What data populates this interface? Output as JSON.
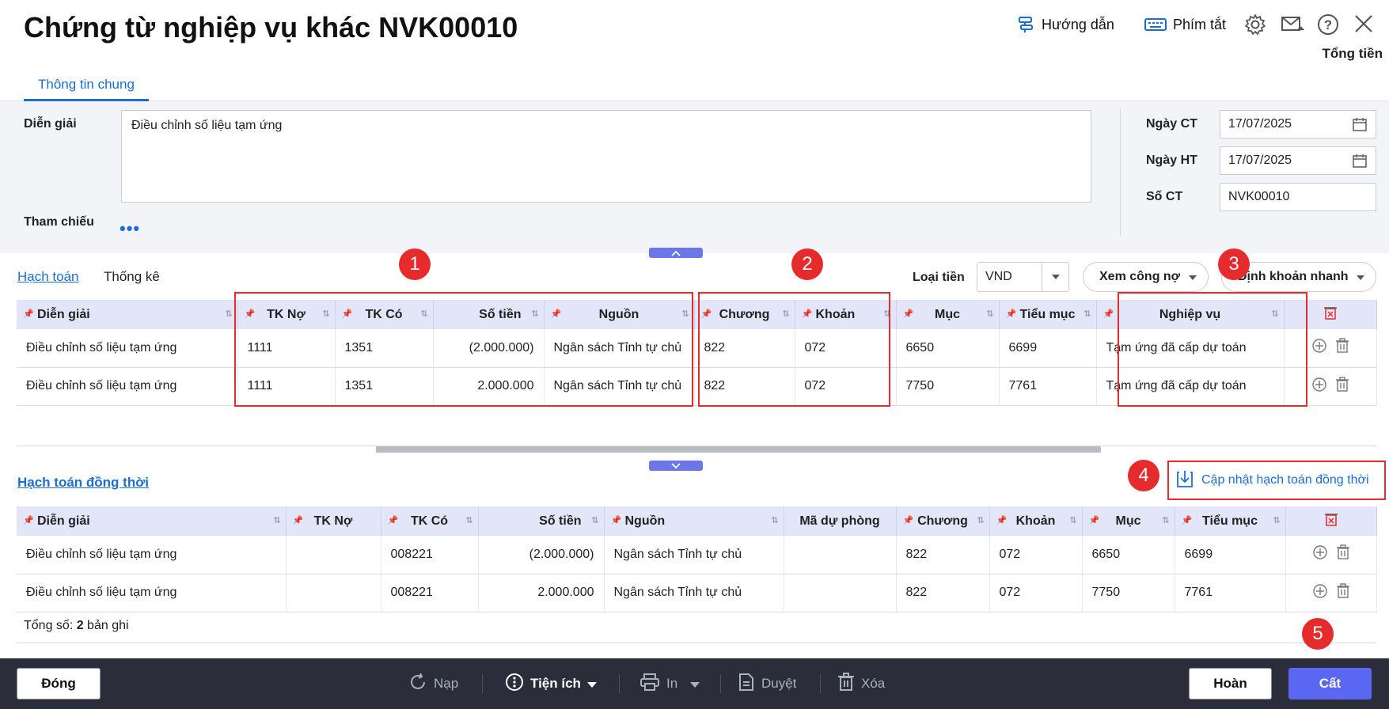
{
  "header": {
    "title": "Chứng từ nghiệp vụ khác NVK00010",
    "guide_label": "Hướng dẫn",
    "shortcut_label": "Phím tắt",
    "total_label": "Tổng tiền"
  },
  "tabs": {
    "general": "Thông tin chung"
  },
  "form": {
    "description_label": "Diễn giải",
    "description_value": "Điều chỉnh số liệu tạm ứng",
    "reference_label": "Tham chiếu",
    "reference_more": "•••",
    "date_ct_label": "Ngày CT",
    "date_ct_value": "17/07/2025",
    "date_ht_label": "Ngày HT",
    "date_ht_value": "17/07/2025",
    "so_ct_label": "Số CT",
    "so_ct_value": "NVK00010"
  },
  "accounting": {
    "tab_active": "Hạch toán",
    "tab_stats": "Thống kê",
    "currency_label": "Loại tiền",
    "currency_value": "VND",
    "debt_button": "Xem công nợ",
    "quick_button": "Định khoản nhanh",
    "columns": [
      "Diễn giải",
      "TK Nợ",
      "TK Có",
      "Số tiền",
      "Nguồn",
      "Chương",
      "Khoản",
      "Mục",
      "Tiểu mục",
      "Nghiệp vụ"
    ],
    "rows": [
      {
        "desc": "Điều chỉnh số liệu tạm ứng",
        "tk_no": "1111",
        "tk_co": "1351",
        "amount": "(2.000.000)",
        "source": "Ngân sách Tỉnh tự chủ",
        "chuong": "822",
        "khoan": "072",
        "muc": "6650",
        "tieu_muc": "6699",
        "nghiep_vu": "Tạm ứng đã cấp dự toán"
      },
      {
        "desc": "Điều chỉnh số liệu tạm ứng",
        "tk_no": "1111",
        "tk_co": "1351",
        "amount": "2.000.000",
        "source": "Ngân sách Tỉnh tự chủ",
        "chuong": "822",
        "khoan": "072",
        "muc": "7750",
        "tieu_muc": "7761",
        "nghiep_vu": "Tạm ứng đã cấp dự toán"
      }
    ]
  },
  "simultaneous": {
    "tab_label": "Hạch toán đồng thời",
    "update_button": "Cập nhật hạch toán đồng thời",
    "columns": [
      "Diễn giải",
      "TK Nợ",
      "TK Có",
      "Số tiền",
      "Nguồn",
      "Mã dự phòng",
      "Chương",
      "Khoản",
      "Mục",
      "Tiểu mục"
    ],
    "rows": [
      {
        "desc": "Điều chỉnh số liệu tạm ứng",
        "tk_no": "",
        "tk_co": "008221",
        "amount": "(2.000.000)",
        "source": "Ngân sách Tỉnh tự chủ",
        "ma_du_phong": "",
        "chuong": "822",
        "khoan": "072",
        "muc": "6650",
        "tieu_muc": "6699"
      },
      {
        "desc": "Điều chỉnh số liệu tạm ứng",
        "tk_no": "",
        "tk_co": "008221",
        "amount": "2.000.000",
        "source": "Ngân sách Tỉnh tự chủ",
        "ma_du_phong": "",
        "chuong": "822",
        "khoan": "072",
        "muc": "7750",
        "tieu_muc": "7761"
      }
    ],
    "total_prefix": "Tổng số: ",
    "total_count": "2",
    "total_suffix": " bản ghi"
  },
  "annotations": [
    "1",
    "2",
    "3",
    "4",
    "5"
  ],
  "footer": {
    "close": "Đóng",
    "reload": "Nạp",
    "utility": "Tiện ích",
    "print": "In",
    "approve": "Duyệt",
    "delete": "Xóa",
    "undo": "Hoàn",
    "save": "Cất"
  },
  "colors": {
    "accent": "#1a6fd6",
    "primary_button": "#5a67f2",
    "annotation": "#e52b2b",
    "header_bg": "#e3e5f8",
    "footer_bg": "#2b2d3b"
  }
}
